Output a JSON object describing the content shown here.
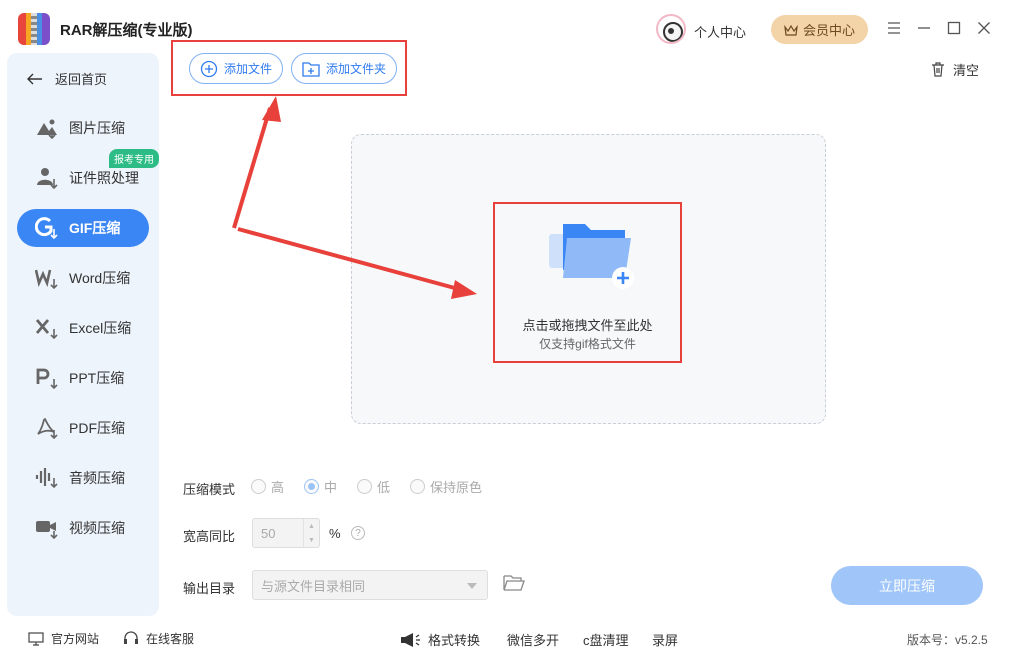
{
  "app": {
    "title": "RAR解压缩(专业版)"
  },
  "header": {
    "user_center": "个人中心",
    "vip": "会员中心"
  },
  "sidebar": {
    "back": "返回首页",
    "items": [
      {
        "label": "图片压缩",
        "icon": "image-icon"
      },
      {
        "label": "证件照处理",
        "icon": "id-photo-icon",
        "badge": "报考专用"
      },
      {
        "label": "GIF压缩",
        "icon": "gif-icon",
        "active": true
      },
      {
        "label": "Word压缩",
        "icon": "word-icon"
      },
      {
        "label": "Excel压缩",
        "icon": "excel-icon"
      },
      {
        "label": "PPT压缩",
        "icon": "ppt-icon"
      },
      {
        "label": "PDF压缩",
        "icon": "pdf-icon"
      },
      {
        "label": "音频压缩",
        "icon": "audio-icon"
      },
      {
        "label": "视频压缩",
        "icon": "video-icon"
      }
    ]
  },
  "toolbar": {
    "add_file": "添加文件",
    "add_folder": "添加文件夹",
    "clear": "清空"
  },
  "dropzone": {
    "title": "点击或拖拽文件至此处",
    "subtitle": "仅支持gif格式文件"
  },
  "settings": {
    "mode_label": "压缩模式",
    "modes": [
      "高",
      "中",
      "低",
      "保持原色"
    ],
    "selected_mode": "中",
    "ratio_label": "宽高同比",
    "ratio_value": "50",
    "ratio_unit": "%",
    "output_label": "输出目录",
    "output_value": "与源文件目录相同",
    "compress_button": "立即压缩"
  },
  "footer": {
    "website": "官方网站",
    "support": "在线客服",
    "format_convert": "格式转换",
    "wechat_multi": "微信多开",
    "c_clean": "c盘清理",
    "record": "录屏",
    "version": "版本号：v5.2.5"
  },
  "colors": {
    "accent": "#3b86f5",
    "highlight": "#e8403a",
    "badge": "#2ebc86",
    "vip": "#f3d3a8"
  }
}
